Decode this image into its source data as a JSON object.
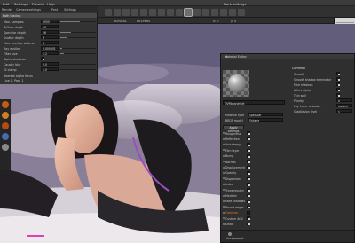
{
  "menubar": {
    "items": [
      "Edit",
      "Settings",
      "Presets",
      "Help",
      "Dark settings"
    ]
  },
  "left_panel": {
    "tabs": [
      "Render",
      "Camera settings",
      "Post",
      "Settings"
    ],
    "section": "Path tracing",
    "rows": [
      {
        "label": "Max. samples",
        "value": "5000",
        "fill": 0.55
      },
      {
        "label": "Diffuse depth",
        "value": "16",
        "fill": 0.3
      },
      {
        "label": "Specular depth",
        "value": "16",
        "fill": 0.3
      },
      {
        "label": "Scatter depth",
        "value": "8",
        "fill": 0.2
      },
      {
        "label": "Max. overlap volumes",
        "value": "4",
        "fill": 0.15
      },
      {
        "label": "Ray epsilon",
        "value": "0.000001",
        "fill": 0.05
      },
      {
        "label": "Filter size",
        "value": "1.2",
        "fill": 0.1
      },
      {
        "label": "Alpha shadows",
        "checked": true
      },
      {
        "label": "Caustic blur",
        "value": "0.0",
        "fill": 0.0
      },
      {
        "label": "GI clamp",
        "value": "1.0",
        "fill": 0.0
      }
    ],
    "tail": [
      "Nearest alpha focus",
      "Live 1, Pass 1"
    ]
  },
  "viewport_header": {
    "items": [
      "NORMAL",
      "HELPERS",
      "x: 0",
      "y: 0"
    ]
  },
  "material_editor": {
    "title": "Material Editor",
    "close": "×",
    "material_name": "OVRbasnelSet",
    "rows": [
      {
        "label": "Material type",
        "dropdown": "Specular"
      },
      {
        "label": "BRDF model",
        "dropdown": "Octane"
      }
    ],
    "button": "Apply settings",
    "channels": [
      {
        "label": "Roughness",
        "checked": true
      },
      {
        "label": "Reflection",
        "checked": true
      },
      {
        "label": "Anisotropy",
        "checked": true
      },
      {
        "label": "Film layer",
        "checked": true
      },
      {
        "label": "Bump",
        "checked": true
      },
      {
        "label": "Normal",
        "checked": true
      },
      {
        "label": "Displacement",
        "checked": true
      },
      {
        "label": "Opacity",
        "checked": true
      },
      {
        "label": "Dispersion",
        "checked": true
      },
      {
        "label": "Index",
        "checked": true
      },
      {
        "label": "Transmission",
        "checked": true
      },
      {
        "label": "Medium",
        "checked": true
      },
      {
        "label": "Fake shadows",
        "checked": true
      },
      {
        "label": "Round edges",
        "checked": true
      },
      {
        "label": "Common",
        "checked": false,
        "highlight": true
      },
      {
        "label": "Custom AOV",
        "checked": true
      },
      {
        "label": "Editor",
        "checked": true
      }
    ],
    "general": {
      "header": "Common",
      "rows": [
        {
          "label": "Smooth",
          "checked": true
        },
        {
          "label": "Smooth shadow terminator",
          "checked": true
        },
        {
          "label": "Fake shadows",
          "checked": true
        },
        {
          "label": "Affect alpha",
          "checked": true
        },
        {
          "label": "Thin wall",
          "checked": true
        },
        {
          "label": "Priority",
          "value": "0"
        },
        {
          "label": "Lay. Layer emission",
          "dropdown": "Default"
        },
        {
          "label": "Subdivision level",
          "value": "1"
        }
      ]
    },
    "footer": "Assignment"
  },
  "colors": {
    "accent_orange": "#f07a1e",
    "panel": "#333333",
    "dark": "#222222"
  },
  "icons": [
    "gear-icon",
    "camera-icon",
    "light-icon",
    "render-icon",
    "material-icon"
  ]
}
